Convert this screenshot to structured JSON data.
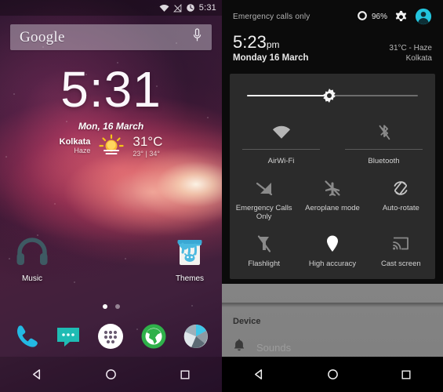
{
  "home": {
    "statusbar": {
      "icons": [
        "wifi-icon",
        "signal-off-icon",
        "alarm-icon"
      ],
      "time": "5:31"
    },
    "search": {
      "brand": "Google",
      "mic_icon": "microphone-icon"
    },
    "clock_widget": {
      "time": "5:31",
      "date": "Mon, 16 March",
      "city": "Kolkata",
      "condition": "Haze",
      "temperature": "31°C",
      "hi_lo": "23° | 34°",
      "weather_icon": "sun-haze-icon"
    },
    "apps": [
      {
        "label": "Music",
        "icon": "headphones-icon"
      },
      {
        "label": "Themes",
        "icon": "paint-bucket-icon"
      }
    ],
    "page_indicator": {
      "total": 2,
      "active": 1
    },
    "dock": [
      {
        "name": "phone",
        "icon": "phone-icon",
        "color": "#23b9e3"
      },
      {
        "name": "messaging",
        "icon": "message-icon",
        "color": "#1fbcb4"
      },
      {
        "name": "app-drawer",
        "icon": "apps-grid-icon",
        "color": "#ffffff"
      },
      {
        "name": "browser",
        "icon": "globe-icon",
        "color": "#2fb14a"
      },
      {
        "name": "camera",
        "icon": "aperture-icon",
        "color": "#b9c2c7"
      }
    ],
    "navbar": [
      {
        "name": "back",
        "icon": "back-triangle-icon"
      },
      {
        "name": "home",
        "icon": "home-circle-icon"
      },
      {
        "name": "recents",
        "icon": "recents-square-icon"
      }
    ]
  },
  "quick_settings": {
    "carrier": "Emergency calls only",
    "battery": {
      "percent": "96%",
      "icon": "battery-ring-icon"
    },
    "gear_icon": "gear-icon",
    "avatar_icon": "user-avatar-icon",
    "avatar_color": "#23c4dd",
    "time": "5:23",
    "time_ampm": "pm",
    "date": "Monday 16 March",
    "weather_line1": "31°C - Haze",
    "weather_line2": "Kolkata",
    "brightness": {
      "icon": "brightness-sun-icon",
      "value": 48
    },
    "tiles_row1": [
      {
        "label": "AirWi-Fi",
        "icon": "wifi-icon",
        "active": true
      },
      {
        "label": "Bluetooth",
        "icon": "bluetooth-off-icon",
        "active": false
      }
    ],
    "tiles_row2": [
      {
        "label": "Emergency Calls Only",
        "icon": "signal-off-icon",
        "active": false
      },
      {
        "label": "Aeroplane mode",
        "icon": "airplane-off-icon",
        "active": false
      },
      {
        "label": "Auto-rotate",
        "icon": "auto-rotate-icon",
        "active": false
      }
    ],
    "tiles_row3": [
      {
        "label": "Flashlight",
        "icon": "flashlight-off-icon",
        "active": false
      },
      {
        "label": "High accuracy",
        "icon": "location-pin-icon",
        "active": true
      },
      {
        "label": "Cast screen",
        "icon": "cast-icon",
        "active": false
      }
    ],
    "device_section": {
      "header": "Device",
      "item_label": "Sounds",
      "item_icon": "bell-icon"
    },
    "navbar": [
      {
        "name": "back",
        "icon": "back-triangle-icon"
      },
      {
        "name": "home",
        "icon": "home-circle-icon"
      },
      {
        "name": "recents",
        "icon": "recents-square-icon"
      }
    ]
  }
}
